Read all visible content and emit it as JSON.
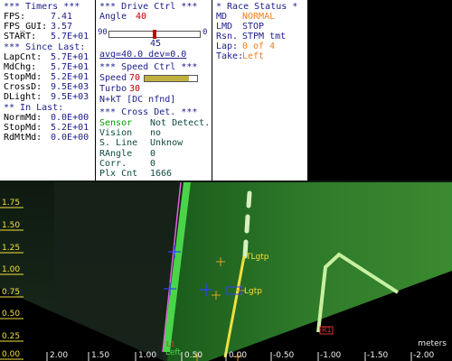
{
  "timers": {
    "header": "*** Timers ***",
    "rows": [
      {
        "label": "FPS:",
        "value": "7.41"
      },
      {
        "label": "FPS_GUI:",
        "value": "3.57"
      },
      {
        "label": "START:",
        "value": "5.7E+01"
      }
    ],
    "since_last_header": "*** Since Last:",
    "since_last": [
      {
        "label": "LapCnt:",
        "value": "5.7E+01"
      },
      {
        "label": "MdChg:",
        "value": "5.7E+01"
      },
      {
        "label": "StopMd:",
        "value": "5.2E+01"
      },
      {
        "label": "CrossD:",
        "value": "9.5E+03"
      },
      {
        "label": "DLight:",
        "value": "9.5E+03"
      }
    ],
    "in_last_header": "** In Last:",
    "in_last": [
      {
        "label": "NormMd:",
        "value": "0.0E+00"
      },
      {
        "label": "StopMd:",
        "value": "5.2E+01"
      },
      {
        "label": "RdMtMd:",
        "value": "0.0E+00"
      }
    ]
  },
  "drive": {
    "header": "***  Drive Ctrl  ***",
    "angle_label": "Angle",
    "angle_value": "40",
    "slider_min": "90",
    "slider_max": "0",
    "slider_value_label": "45",
    "slider_fraction": 0.5,
    "avg_line": "avg=40.0  dev=0.0",
    "speed_header": "***  Speed Ctrl  ***",
    "speed_label": "Speed",
    "speed_value": "70",
    "speed_fraction": 0.85,
    "turbo_label": "Turbo",
    "turbo_value": "30",
    "nkt_line": "N+kT [DC nfnd]",
    "cross_header": "*** Cross Det. ***",
    "cross_rows": [
      {
        "label": "Sensor",
        "value": "Not Detect."
      },
      {
        "label": "Vision",
        "value": "no"
      },
      {
        "label": "S. Line",
        "value": "Unknow"
      },
      {
        "label": "RAngle",
        "value": "0"
      },
      {
        "label": "Corr.",
        "value": "0"
      },
      {
        "label": "Plx Cnt",
        "value": "1666"
      }
    ]
  },
  "race": {
    "header": "* Race Status *",
    "rows": [
      {
        "label": "MD",
        "value": "NORMAL"
      },
      {
        "label": "LMD",
        "value": "STOP"
      },
      {
        "label": "Rsn.",
        "value": "STPM tmt"
      },
      {
        "label": "Lap:",
        "value": "0 of 4"
      },
      {
        "label": "Take:",
        "value": "Left"
      }
    ]
  },
  "camera": {
    "y_ticks": [
      "1.75",
      "1.50",
      "1.25",
      "1.00",
      "0.75",
      "0.50",
      "0.25",
      "0.00"
    ],
    "x_ticks": [
      "2.00",
      "1.50",
      "1.00",
      "0.50",
      "0.00",
      "-0.50",
      "-1.00",
      "-1.50",
      "-2.00"
    ],
    "units": "meters",
    "tag_tlgtp": "TLgtp",
    "tag_lgtp": "Lgtp",
    "tag_left": "Left",
    "tag_l1": "L1",
    "tag_r1": "R1"
  },
  "colors": {
    "panel_text": "#1c1c8c",
    "value_orange": "#f08020",
    "value_red": "#c00000",
    "axis_yellow": "#f0e040",
    "lane_green": "#4ad44a"
  }
}
